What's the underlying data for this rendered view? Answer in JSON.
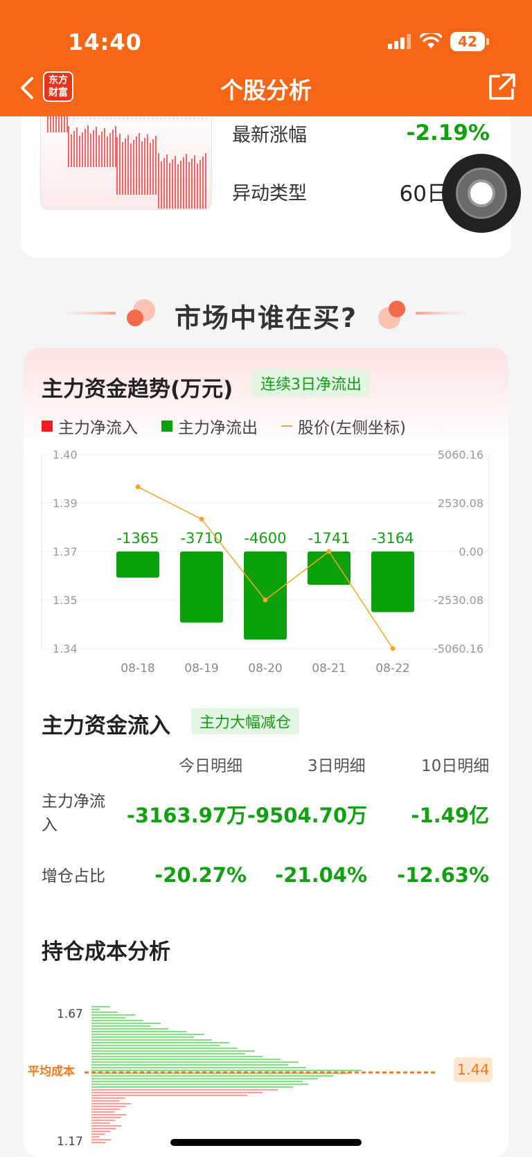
{
  "status": {
    "time": "14:40",
    "battery": "42"
  },
  "nav": {
    "logo_line1": "东方",
    "logo_line2": "财富",
    "title": "个股分析"
  },
  "top_card": {
    "rows": [
      {
        "label": "最新涨幅",
        "value": "-2.19%"
      },
      {
        "label": "异动类型",
        "value": "60日"
      }
    ]
  },
  "section_title": "市场中谁在买?",
  "trend": {
    "title": "主力资金趋势(万元)",
    "tag": "连续3日净流出",
    "legend": [
      "主力净流入",
      "主力净流出",
      "股价(左侧坐标)"
    ],
    "colors": {
      "inflow": "#f01e1e",
      "outflow": "#0aa00a",
      "price": "#f5a623"
    }
  },
  "chart_data": {
    "type": "bar",
    "categories": [
      "08-18",
      "08-19",
      "08-20",
      "08-21",
      "08-22"
    ],
    "series": [
      {
        "name": "主力净流出",
        "values": [
          -1365,
          -3710,
          -4600,
          -1741,
          -3164
        ],
        "axis": "right"
      },
      {
        "name": "股价(左侧坐标)",
        "values": [
          1.39,
          1.38,
          1.355,
          1.37,
          1.34
        ],
        "axis": "left",
        "kind": "line"
      }
    ],
    "data_labels": [
      "-1365",
      "-3710",
      "-4600",
      "-1741",
      "-3164"
    ],
    "left_ticks": [
      "1.40",
      "1.39",
      "1.37",
      "1.35",
      "1.34"
    ],
    "left_ylim": [
      1.34,
      1.4
    ],
    "right_ticks": [
      "5060.16",
      "2530.08",
      "0.00",
      "-2530.08",
      "-5060.16"
    ],
    "right_ylim": [
      -5060.16,
      5060.16
    ],
    "grid": true
  },
  "flow": {
    "title": "主力资金流入",
    "tag": "主力大幅减仓",
    "headers": [
      "今日明细",
      "3日明细",
      "10日明细"
    ],
    "rows": [
      {
        "label": "主力净流入",
        "values": [
          "-3163.97万",
          "-9504.70万",
          "-1.49亿"
        ]
      },
      {
        "label": "增仓占比",
        "values": [
          "-20.27%",
          "-21.04%",
          "-12.63%"
        ]
      }
    ]
  },
  "cost": {
    "title": "持仓成本分析",
    "avg_label": "平均成本",
    "avg_value": "1.44",
    "top_tick": "1.67",
    "bottom_tick": "1.17"
  }
}
